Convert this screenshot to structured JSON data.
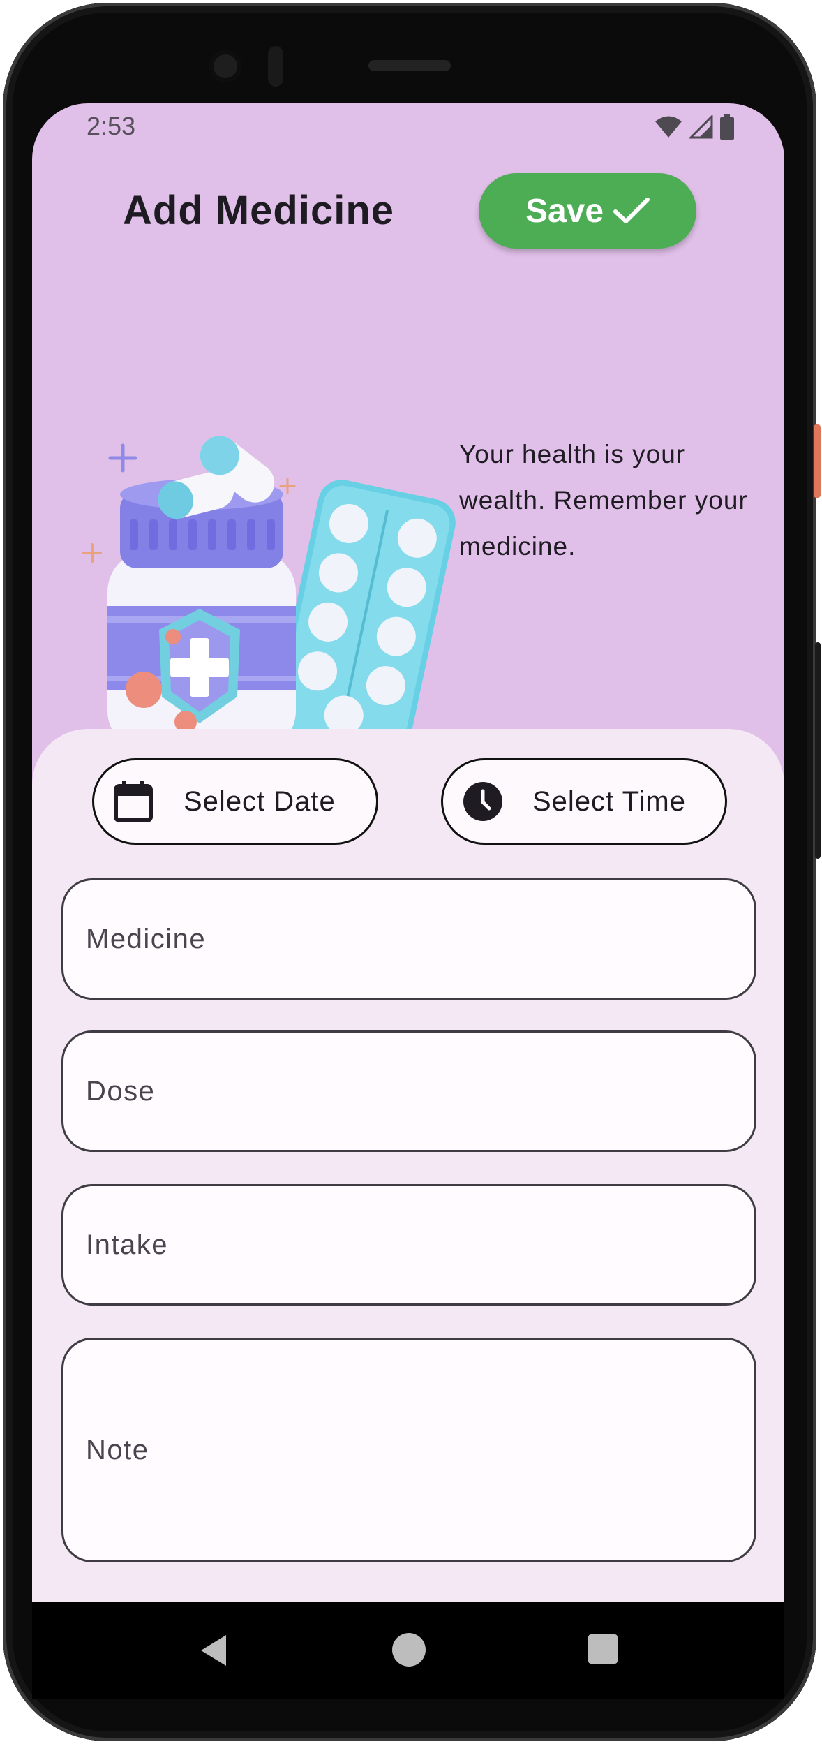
{
  "status_bar": {
    "time": "2:53"
  },
  "header": {
    "title": "Add Medicine",
    "save_label": "Save"
  },
  "hero": {
    "tagline": "Your health is your wealth. Remember your medicine."
  },
  "form": {
    "date_label": "Select Date",
    "time_label": "Select Time",
    "fields": [
      {
        "label": "Medicine"
      },
      {
        "label": "Dose"
      },
      {
        "label": "Intake"
      },
      {
        "label": "Note"
      }
    ]
  },
  "colors": {
    "top_background": "#e0bfe8",
    "panel_background": "#f3e8f4",
    "save_button": "#4cad55"
  },
  "icons": {
    "save": "check-icon",
    "date": "calendar-icon",
    "time": "clock-icon",
    "nav": [
      "back-triangle-icon",
      "home-circle-icon",
      "recents-square-icon"
    ]
  }
}
